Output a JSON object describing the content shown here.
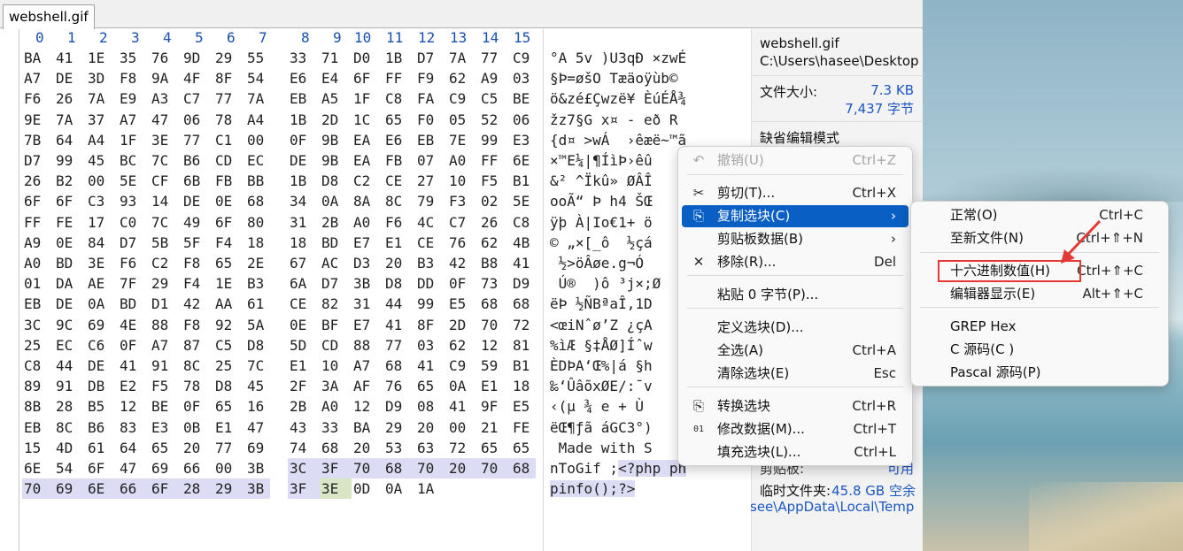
{
  "tab": {
    "label": "webshell.gif"
  },
  "column_headers": [
    "0",
    "1",
    "2",
    "3",
    "4",
    "5",
    "6",
    "7",
    "8",
    "9",
    "10",
    "11",
    "12",
    "13",
    "14",
    "15"
  ],
  "hex_rows": [
    {
      "bytes": [
        "BA",
        "41",
        "1E",
        "35",
        "76",
        "9D",
        "29",
        "55",
        "33",
        "71",
        "D0",
        "1B",
        "D7",
        "7A",
        "77",
        "C9"
      ],
      "ascii": "°A 5v )U3qÐ ×zwÉ"
    },
    {
      "bytes": [
        "A7",
        "DE",
        "3D",
        "F8",
        "9A",
        "4F",
        "8F",
        "54",
        "E6",
        "E4",
        "6F",
        "FF",
        "F9",
        "62",
        "A9",
        "03"
      ],
      "ascii": "§Þ=øšO Tæäoÿùb©"
    },
    {
      "bytes": [
        "F6",
        "26",
        "7A",
        "E9",
        "A3",
        "C7",
        "77",
        "7A",
        "EB",
        "A5",
        "1F",
        "C8",
        "FA",
        "C9",
        "C5",
        "BE"
      ],
      "ascii": "ö&zé£Çwzë¥ ÈúÉÅ¾"
    },
    {
      "bytes": [
        "9E",
        "7A",
        "37",
        "A7",
        "47",
        "06",
        "78",
        "A4",
        "1B",
        "2D",
        "1C",
        "65",
        "F0",
        "05",
        "52",
        "06"
      ],
      "ascii": "žz7§G x¤ - eð R"
    },
    {
      "bytes": [
        "7B",
        "64",
        "A4",
        "1F",
        "3E",
        "77",
        "C1",
        "00",
        "0F",
        "9B",
        "EA",
        "E6",
        "EB",
        "7E",
        "99",
        "E3"
      ],
      "ascii": "{d¤ >wÁ  ›êæë~™ã"
    },
    {
      "bytes": [
        "D7",
        "99",
        "45",
        "BC",
        "7C",
        "B6",
        "CD",
        "EC",
        "DE",
        "9B",
        "EA",
        "FB",
        "07",
        "A0",
        "FF",
        "6E"
      ],
      "ascii": "×™E¼|¶ÍìÞ›êû"
    },
    {
      "bytes": [
        "26",
        "B2",
        "00",
        "5E",
        "CF",
        "6B",
        "FB",
        "BB",
        "1B",
        "D8",
        "C2",
        "CE",
        "27",
        "10",
        "F5",
        "B1"
      ],
      "ascii": "&² ^Ïkû» ØÂÎ"
    },
    {
      "bytes": [
        "6F",
        "6F",
        "C3",
        "93",
        "14",
        "DE",
        "0E",
        "68",
        "34",
        "0A",
        "8A",
        "8C",
        "79",
        "F3",
        "02",
        "5E"
      ],
      "ascii": "ooÃ“ Þ h4 ŠŒ"
    },
    {
      "bytes": [
        "FF",
        "FE",
        "17",
        "C0",
        "7C",
        "49",
        "6F",
        "80",
        "31",
        "2B",
        "A0",
        "F6",
        "4C",
        "C7",
        "26",
        "C8"
      ],
      "ascii": "ÿþ À|Io€1+ ö"
    },
    {
      "bytes": [
        "A9",
        "0E",
        "84",
        "D7",
        "5B",
        "5F",
        "F4",
        "18",
        "18",
        "BD",
        "E7",
        "E1",
        "CE",
        "76",
        "62",
        "4B"
      ],
      "ascii": "© „×[_ô  ½çá"
    },
    {
      "bytes": [
        "A0",
        "BD",
        "3E",
        "F6",
        "C2",
        "F8",
        "65",
        "2E",
        "67",
        "AC",
        "D3",
        "20",
        "B3",
        "42",
        "B8",
        "41"
      ],
      "ascii": " ½>öÂøe.g¬Ó"
    },
    {
      "bytes": [
        "01",
        "DA",
        "AE",
        "7F",
        "29",
        "F4",
        "1E",
        "B3",
        "6A",
        "D7",
        "3B",
        "D8",
        "DD",
        "0F",
        "73",
        "D9"
      ],
      "ascii": " Ú®  )ô ³j×;Ø"
    },
    {
      "bytes": [
        "EB",
        "DE",
        "0A",
        "BD",
        "D1",
        "42",
        "AA",
        "61",
        "CE",
        "82",
        "31",
        "44",
        "99",
        "E5",
        "68",
        "68"
      ],
      "ascii": "ëÞ ½ÑBªaÎ‚1D"
    },
    {
      "bytes": [
        "3C",
        "9C",
        "69",
        "4E",
        "88",
        "F8",
        "92",
        "5A",
        "0E",
        "BF",
        "E7",
        "41",
        "8F",
        "2D",
        "70",
        "72"
      ],
      "ascii": "<œiNˆø’Z ¿çA"
    },
    {
      "bytes": [
        "25",
        "EC",
        "C6",
        "0F",
        "A7",
        "87",
        "C5",
        "D8",
        "5D",
        "CD",
        "88",
        "77",
        "03",
        "62",
        "12",
        "81"
      ],
      "ascii": "%ìÆ §‡ÅØ]Íˆw"
    },
    {
      "bytes": [
        "C8",
        "44",
        "DE",
        "41",
        "91",
        "8C",
        "25",
        "7C",
        "E1",
        "10",
        "A7",
        "68",
        "41",
        "C9",
        "59",
        "B1"
      ],
      "ascii": "ÈDÞA‘Œ%|á §h"
    },
    {
      "bytes": [
        "89",
        "91",
        "DB",
        "E2",
        "F5",
        "78",
        "D8",
        "45",
        "2F",
        "3A",
        "AF",
        "76",
        "65",
        "0A",
        "E1",
        "18"
      ],
      "ascii": "‰‘ÛâõxØE/:¯v"
    },
    {
      "bytes": [
        "8B",
        "28",
        "B5",
        "12",
        "BE",
        "0F",
        "65",
        "16",
        "2B",
        "A0",
        "12",
        "D9",
        "08",
        "41",
        "9F",
        "E5"
      ],
      "ascii": "‹(µ ¾ e + Ù"
    },
    {
      "bytes": [
        "EB",
        "8C",
        "B6",
        "83",
        "E3",
        "0B",
        "E1",
        "47",
        "43",
        "33",
        "BA",
        "29",
        "20",
        "00",
        "21",
        "FE"
      ],
      "ascii": "ëŒ¶ƒã áGC3°)"
    },
    {
      "bytes": [
        "15",
        "4D",
        "61",
        "64",
        "65",
        "20",
        "77",
        "69",
        "74",
        "68",
        "20",
        "53",
        "63",
        "72",
        "65",
        "65"
      ],
      "ascii": " Made with S"
    },
    {
      "bytes": [
        "6E",
        "54",
        "6F",
        "47",
        "69",
        "66",
        "00",
        "3B",
        "3C",
        "3F",
        "70",
        "68",
        "70",
        "20",
        "70",
        "68"
      ],
      "ascii": "nToGif ;<?php ph"
    },
    {
      "bytes": [
        "70",
        "69",
        "6E",
        "66",
        "6F",
        "28",
        "29",
        "3B",
        "3F",
        "3E",
        "0D",
        "0A",
        "1A"
      ],
      "ascii": "pinfo();?>"
    }
  ],
  "info": {
    "file_name": "webshell.gif",
    "file_path": "C:\\Users\\hasee\\Desktop",
    "size_label": "文件大小:",
    "size_kb": "7.3 KB",
    "size_bytes": "7,437 字节",
    "mode_label": "缺省编辑模式",
    "clipboard_label": "剪贴板:",
    "clipboard_value": "可用",
    "temp_label": "临时文件夹:",
    "temp_value": "45.8 GB 空余",
    "temp_path": "see\\AppData\\Local\\Temp"
  },
  "context_menu": {
    "items": [
      {
        "icon": "undo-icon",
        "glyph": "↶",
        "label": "撤销(U)",
        "shortcut": "Ctrl+Z",
        "disabled": true
      },
      {
        "icon": "scissors-icon",
        "glyph": "✂",
        "label": "剪切(T)...",
        "shortcut": "Ctrl+X"
      },
      {
        "icon": "copy-block-icon",
        "glyph": "⎘",
        "label": "复制选块(C)",
        "shortcut": "›",
        "highlighted": true
      },
      {
        "icon": "",
        "glyph": "",
        "label": "剪贴板数据(B)",
        "shortcut": "›"
      },
      {
        "icon": "remove-icon",
        "glyph": "✕",
        "label": "移除(R)...",
        "shortcut": "Del"
      },
      {
        "icon": "",
        "glyph": "",
        "label": "粘贴 0 字节(P)...",
        "shortcut": ""
      },
      {
        "icon": "",
        "glyph": "",
        "label": "定义选块(D)...",
        "shortcut": ""
      },
      {
        "icon": "",
        "glyph": "",
        "label": "全选(A)",
        "shortcut": "Ctrl+A"
      },
      {
        "icon": "",
        "glyph": "",
        "label": "清除选块(E)",
        "shortcut": "Esc"
      },
      {
        "icon": "convert-icon",
        "glyph": "⎘",
        "label": "转换选块",
        "shortcut": "Ctrl+R"
      },
      {
        "icon": "modify-data-icon",
        "glyph": "01",
        "label": "修改数据(M)...",
        "shortcut": "Ctrl+T"
      },
      {
        "icon": "",
        "glyph": "",
        "label": "填充选块(L)...",
        "shortcut": "Ctrl+L"
      }
    ]
  },
  "submenu": {
    "items": [
      {
        "label": "正常(O)",
        "shortcut": "Ctrl+C"
      },
      {
        "label": "至新文件(N)",
        "shortcut": "Ctrl+⇑+N"
      },
      {
        "label": "十六进制数值(H)",
        "shortcut": "Ctrl+⇑+C",
        "boxed": true
      },
      {
        "label": "编辑器显示(E)",
        "shortcut": "Alt+⇑+C"
      },
      {
        "label": "GREP Hex",
        "shortcut": ""
      },
      {
        "label": "C 源码(C )",
        "shortcut": ""
      },
      {
        "label": "Pascal 源码(P)",
        "shortcut": ""
      }
    ]
  },
  "colors": {
    "selection": "#dcdcf4",
    "menu_highlight": "#0a5fc4",
    "annotation": "#e53935",
    "header_blue": "#1a4fb0"
  }
}
